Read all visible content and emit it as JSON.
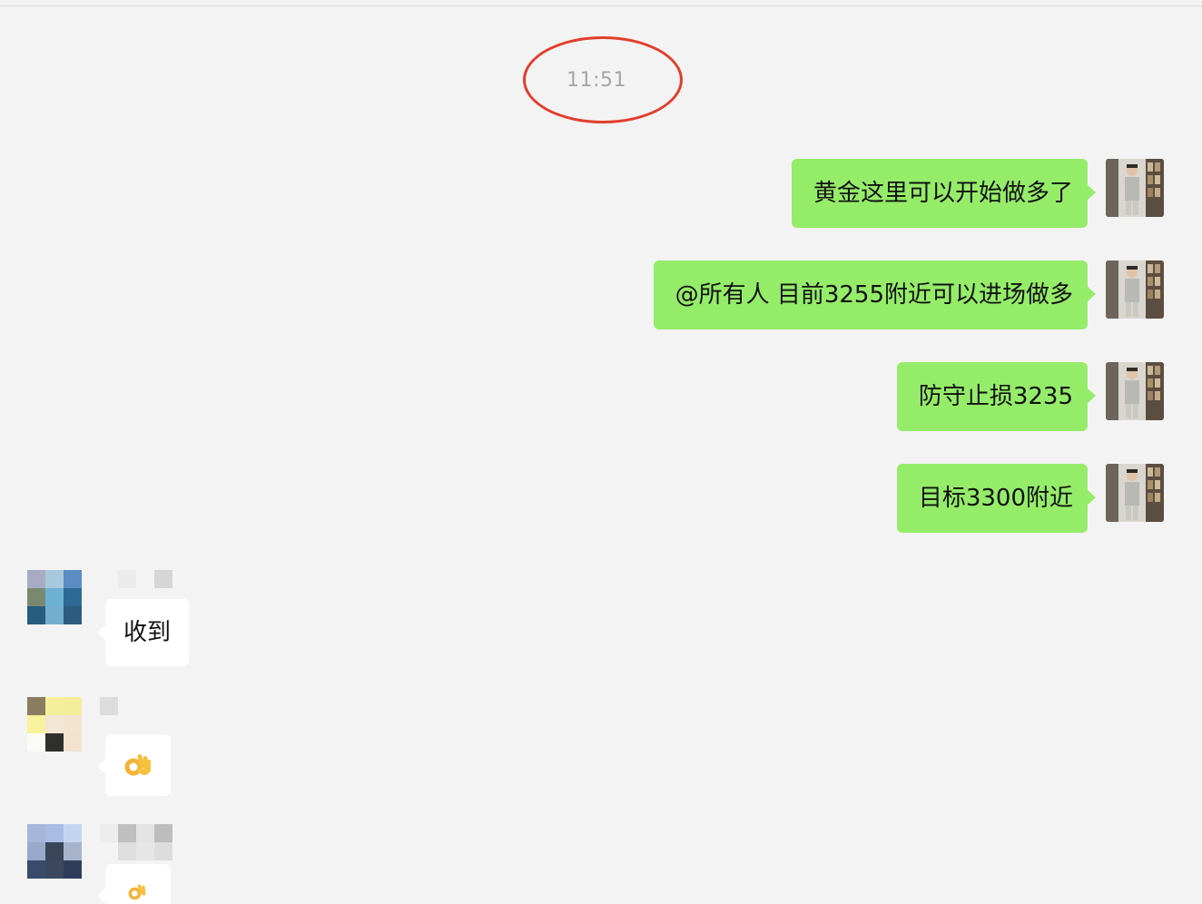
{
  "chat": {
    "timestamp": "11:51",
    "outgoing_messages": [
      {
        "text": "黄金这里可以开始做多了"
      },
      {
        "text": "@所有人 目前3255附近可以进场做多"
      },
      {
        "text": "防守止损3235"
      },
      {
        "text": "目标3300附近"
      }
    ],
    "incoming_messages": [
      {
        "type": "text",
        "text": "收到"
      },
      {
        "type": "emoji",
        "icon": "ok-hand-icon"
      },
      {
        "type": "emoji",
        "icon": "ok-hand-icon"
      }
    ]
  },
  "colors": {
    "outgoing_bubble": "#95ec69",
    "incoming_bubble": "#ffffff",
    "background": "#f3f3f3",
    "highlight_circle": "#e13e2c",
    "timestamp_text": "#a6a6a6"
  }
}
